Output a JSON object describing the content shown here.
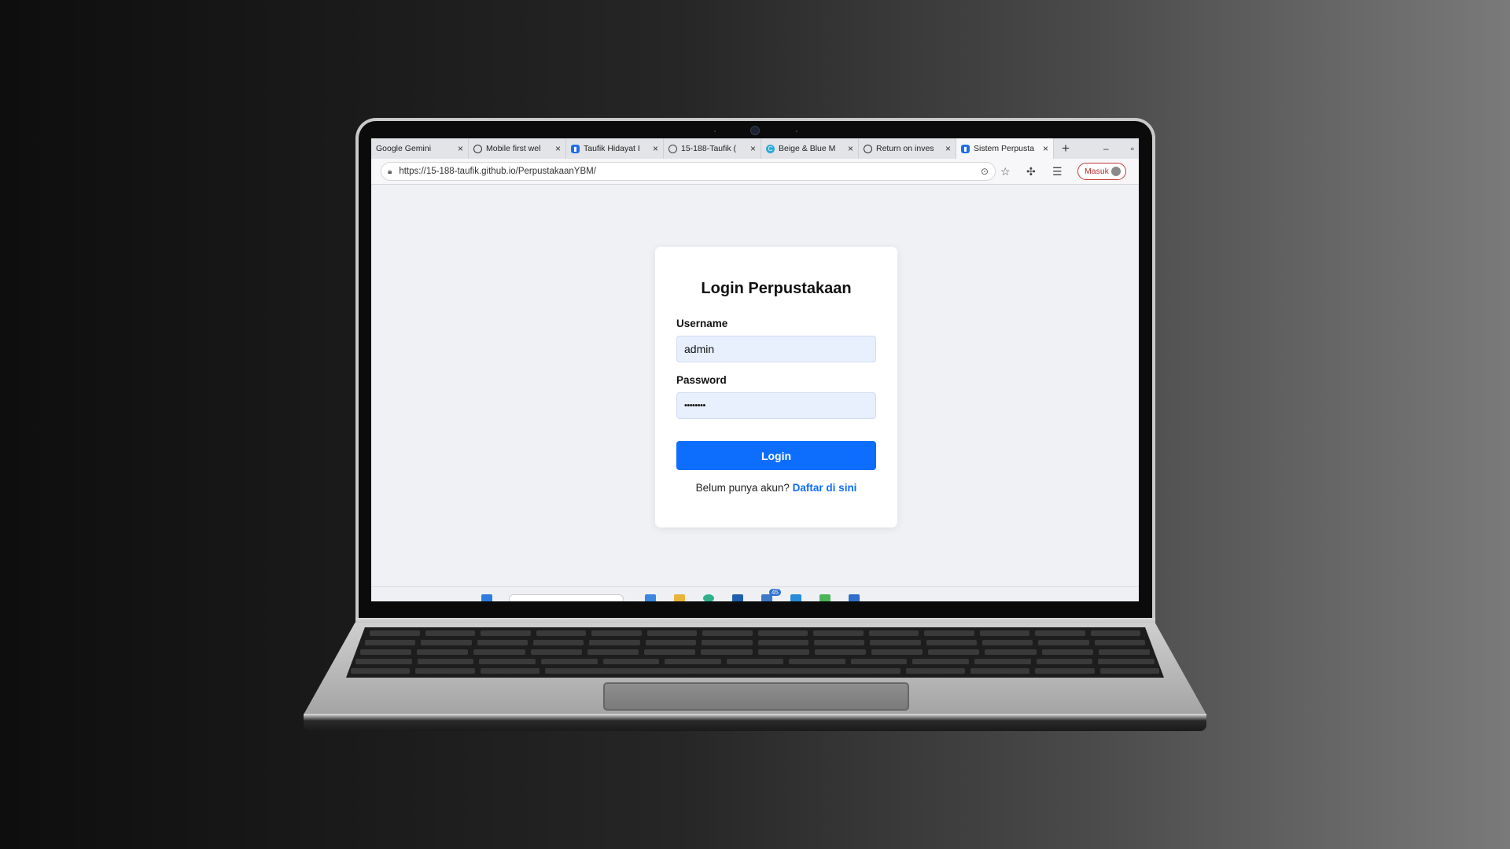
{
  "browser": {
    "tabs": [
      {
        "label": "Google Gemini",
        "icon": "gemini-icon",
        "active": false
      },
      {
        "label": "Mobile first wel",
        "icon": "openai-icon",
        "active": false
      },
      {
        "label": "Taufik Hidayat I",
        "icon": "app-icon",
        "active": false
      },
      {
        "label": "15-188-Taufik (",
        "icon": "github-icon",
        "active": false
      },
      {
        "label": "Beige & Blue M",
        "icon": "canva-icon",
        "active": false
      },
      {
        "label": "Return on inves",
        "icon": "openai-icon",
        "active": false
      },
      {
        "label": "Sistem Perpusta",
        "icon": "app-icon",
        "active": true
      }
    ],
    "new_tab": "+",
    "minimize": "–",
    "url": "https://15-188-taufik.github.io/PerpustakaanYBM/",
    "profile_label": "Masuk"
  },
  "login": {
    "title": "Login Perpustakaan",
    "username_label": "Username",
    "username_value": "admin",
    "password_label": "Password",
    "password_value": "••••••••",
    "button": "Login",
    "register_prompt": "Belum punya akun?",
    "register_link": "Daftar di sini"
  },
  "taskbar": {
    "badge_count": "45"
  },
  "colors": {
    "accent": "#0d6efd",
    "input_bg": "#e8f0fd",
    "page_bg": "#f0f1f5",
    "profile_border": "#c43b3b"
  }
}
